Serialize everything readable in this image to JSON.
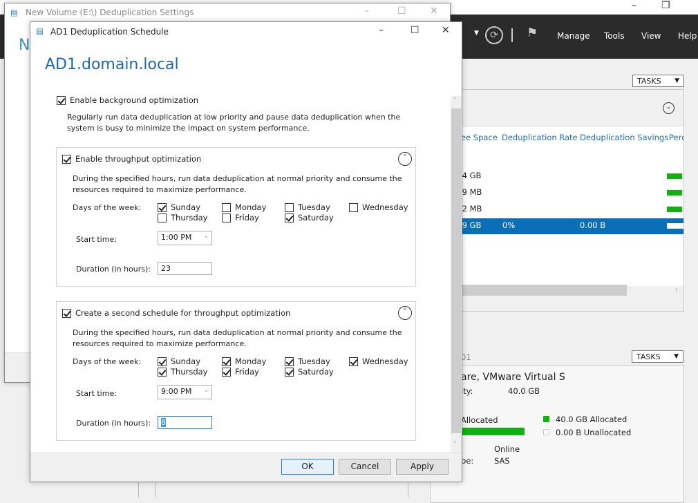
{
  "server_manager": {
    "menu": [
      "Manage",
      "Tools",
      "View",
      "Help"
    ],
    "tasks_label": "TASKS",
    "volumes_columns": [
      "ee Space",
      "Deduplication Rate",
      "Deduplication Savings",
      "Perc"
    ],
    "rows": [
      {
        "free": ".4 GB",
        "rate": "",
        "savings": "",
        "pct": 0.9
      },
      {
        "free": ".9 MB",
        "rate": "",
        "savings": "",
        "pct": 0.9
      },
      {
        "free": ".2 MB",
        "rate": "",
        "savings": "",
        "pct": 0.9
      },
      {
        "free": ".9 GB",
        "rate": "0%",
        "savings": "0.00 B",
        "pct": 0.0,
        "selected": true
      }
    ],
    "disk": {
      "header": "01",
      "name": "are, VMware Virtual S",
      "capacity_label": "ity:",
      "capacity": "40.0 GB",
      "allocated_label": "Allocated",
      "legend_allocated": "40.0 GB Allocated",
      "legend_unallocated": "0.00 B Unallocated",
      "status_label": "",
      "status": "Online",
      "bus_label": "pe:",
      "bus": "SAS",
      "allocated_fraction": 1.0
    },
    "accent": "#0b6fb8",
    "bar_color": "#12b012"
  },
  "back_window": {
    "title": "New Volume (E:\\) Deduplication Settings",
    "heading_initial": "N"
  },
  "dialog": {
    "title": "AD1 Deduplication Schedule",
    "heading": "AD1.domain.local",
    "bg_opt": {
      "label": "Enable background optimization",
      "checked": true,
      "desc": "Regularly run data deduplication at low priority and pause data deduplication when the system is busy to minimize the impact on system performance."
    },
    "schedule1": {
      "label": "Enable throughput optimization",
      "checked": true,
      "desc": "During the specified hours, run data deduplication at normal priority and consume the resources required to maximize performance.",
      "days_label": "Days of the week:",
      "days": [
        {
          "name": "Sunday",
          "checked": true
        },
        {
          "name": "Monday",
          "checked": false
        },
        {
          "name": "Tuesday",
          "checked": false
        },
        {
          "name": "Wednesday",
          "checked": false
        },
        {
          "name": "Thursday",
          "checked": false
        },
        {
          "name": "Friday",
          "checked": false
        },
        {
          "name": "Saturday",
          "checked": true
        }
      ],
      "start_label": "Start time:",
      "start": "1:00 PM",
      "duration_label": "Duration (in hours):",
      "duration": "23"
    },
    "schedule2": {
      "label": "Create a second schedule for throughput optimization",
      "checked": true,
      "desc": "During the specified hours, run data deduplication at normal priority and consume the resources required to maximize performance.",
      "days_label": "Days of the week:",
      "days": [
        {
          "name": "Sunday",
          "checked": true
        },
        {
          "name": "Monday",
          "checked": true
        },
        {
          "name": "Tuesday",
          "checked": true
        },
        {
          "name": "Wednesday",
          "checked": true
        },
        {
          "name": "Thursday",
          "checked": true
        },
        {
          "name": "Friday",
          "checked": true
        },
        {
          "name": "Saturday",
          "checked": true
        }
      ],
      "start_label": "Start time:",
      "start": "9:00 PM",
      "duration_label": "Duration (in hours):",
      "duration": "8"
    },
    "buttons": {
      "ok": "OK",
      "cancel": "Cancel",
      "apply": "Apply"
    }
  }
}
